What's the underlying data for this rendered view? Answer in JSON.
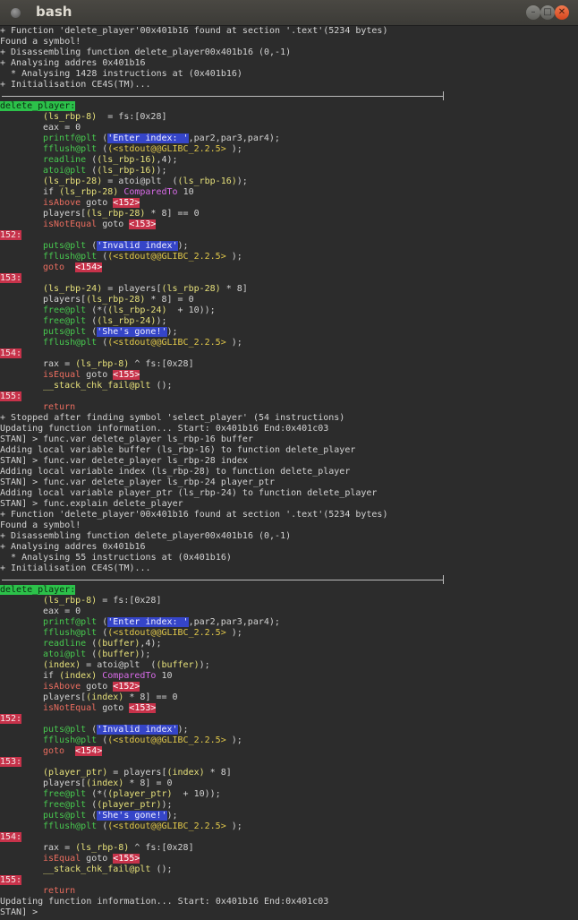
{
  "window": {
    "title": "bash"
  },
  "prompt": "STAN] >",
  "terminal_lines": [
    {
      "t": "text",
      "s": "+ Function 'delete_player'00x401b16 found at section '.text'(5234 bytes)"
    },
    {
      "t": "text",
      "s": "Found a symbol!"
    },
    {
      "t": "text",
      "s": "+ Disassembling function delete_player00x401b16 (0,-1)"
    },
    {
      "t": "text",
      "s": "+ Analysing addres 0x401b16"
    },
    {
      "t": "text",
      "s": "  * Analysing 1428 instructions at (0x401b16)"
    },
    {
      "t": "text",
      "s": "+ Initialisation CE4S(TM)..."
    },
    {
      "t": "sep"
    },
    {
      "t": "label",
      "s": "delete_player:"
    },
    {
      "t": "code",
      "segs": [
        [
          "y",
          "(ls_rbp-8)"
        ],
        [
          "",
          "  = fs:[0x28]"
        ]
      ]
    },
    {
      "t": "code",
      "segs": [
        [
          "",
          "eax = 0"
        ]
      ]
    },
    {
      "t": "code",
      "segs": [
        [
          "g",
          "printf@plt"
        ],
        [
          "",
          " ("
        ],
        [
          "str",
          "'Enter index: '"
        ],
        [
          "",
          ",par2,par3,par4);"
        ]
      ]
    },
    {
      "t": "code",
      "segs": [
        [
          "g",
          "fflush@plt"
        ],
        [
          "",
          " ("
        ],
        [
          "stdout",
          "(<stdout@@GLIBC_2.2.5>"
        ],
        [
          "",
          " );"
        ]
      ]
    },
    {
      "t": "code",
      "segs": [
        [
          "g",
          "readline"
        ],
        [
          "",
          " ("
        ],
        [
          "y",
          "(ls_rbp-16)"
        ],
        [
          "",
          ",4);"
        ]
      ]
    },
    {
      "t": "code",
      "segs": [
        [
          "g",
          "atoi@plt"
        ],
        [
          "",
          " ("
        ],
        [
          "y",
          "(ls_rbp-16)"
        ],
        [
          "",
          ");"
        ]
      ]
    },
    {
      "t": "code",
      "segs": [
        [
          "y",
          "(ls_rbp-28)"
        ],
        [
          "",
          " = atoi@plt  ("
        ],
        [
          "y",
          "(ls_rbp-16)"
        ],
        [
          "",
          ");"
        ]
      ]
    },
    {
      "t": "code",
      "segs": [
        [
          "",
          "if "
        ],
        [
          "y",
          "(ls_rbp-28)"
        ],
        [
          "",
          " "
        ],
        [
          "m",
          "ComparedTo"
        ],
        [
          "",
          " 10"
        ]
      ]
    },
    {
      "t": "code",
      "segs": [
        [
          "r",
          "isAbove"
        ],
        [
          "",
          " goto "
        ],
        [
          "tgt",
          "<152>"
        ]
      ]
    },
    {
      "t": "code",
      "segs": [
        [
          "",
          "players["
        ],
        [
          "y",
          "(ls_rbp-28)"
        ],
        [
          "",
          " * 8] == 0"
        ]
      ]
    },
    {
      "t": "code",
      "segs": [
        [
          "r",
          "isNotEqual"
        ],
        [
          "",
          " goto "
        ],
        [
          "tgt",
          "<153>"
        ]
      ]
    },
    {
      "t": "rlabel",
      "s": "152:"
    },
    {
      "t": "code",
      "segs": [
        [
          "g",
          "puts@plt"
        ],
        [
          "",
          " ("
        ],
        [
          "str",
          "'Invalid index'"
        ],
        [
          "",
          ");"
        ]
      ]
    },
    {
      "t": "code",
      "segs": [
        [
          "g",
          "fflush@plt"
        ],
        [
          "",
          " ("
        ],
        [
          "stdout",
          "(<stdout@@GLIBC_2.2.5>"
        ],
        [
          "",
          " );"
        ]
      ]
    },
    {
      "t": "code",
      "segs": [
        [
          "r",
          "goto"
        ],
        [
          "",
          "  "
        ],
        [
          "tgt",
          "<154>"
        ]
      ]
    },
    {
      "t": "rlabel",
      "s": "153:"
    },
    {
      "t": "code",
      "segs": [
        [
          "y",
          "(ls_rbp-24)"
        ],
        [
          "",
          " = players["
        ],
        [
          "y",
          "(ls_rbp-28)"
        ],
        [
          "",
          " * 8]"
        ]
      ]
    },
    {
      "t": "code",
      "segs": [
        [
          "",
          "players["
        ],
        [
          "y",
          "(ls_rbp-28)"
        ],
        [
          "",
          " * 8] = 0"
        ]
      ]
    },
    {
      "t": "code",
      "segs": [
        [
          "g",
          "free@plt"
        ],
        [
          "",
          " (*("
        ],
        [
          "y",
          "(ls_rbp-24)"
        ],
        [
          "",
          "  + 10));"
        ]
      ]
    },
    {
      "t": "code",
      "segs": [
        [
          "g",
          "free@plt"
        ],
        [
          "",
          " ("
        ],
        [
          "y",
          "(ls_rbp-24)"
        ],
        [
          "",
          ");"
        ]
      ]
    },
    {
      "t": "code",
      "segs": [
        [
          "g",
          "puts@plt"
        ],
        [
          "",
          " ("
        ],
        [
          "str",
          "'She's gone!'"
        ],
        [
          "",
          ");"
        ]
      ]
    },
    {
      "t": "code",
      "segs": [
        [
          "g",
          "fflush@plt"
        ],
        [
          "",
          " ("
        ],
        [
          "stdout",
          "(<stdout@@GLIBC_2.2.5>"
        ],
        [
          "",
          " );"
        ]
      ]
    },
    {
      "t": "rlabel",
      "s": "154:"
    },
    {
      "t": "code",
      "segs": [
        [
          "",
          "rax = "
        ],
        [
          "y",
          "(ls_rbp-8)"
        ],
        [
          "",
          " ^ fs:[0x28]"
        ]
      ]
    },
    {
      "t": "code",
      "segs": [
        [
          "r",
          "isEqual"
        ],
        [
          "",
          " goto "
        ],
        [
          "tgt",
          "<155>"
        ]
      ]
    },
    {
      "t": "code",
      "segs": [
        [
          "y",
          "__stack_chk_fail@plt"
        ],
        [
          "",
          " ();"
        ]
      ]
    },
    {
      "t": "rlabel",
      "s": "155:"
    },
    {
      "t": "code",
      "segs": [
        [
          "r",
          "return"
        ]
      ]
    },
    {
      "t": "text",
      "s": "+ Stopped after finding symbol 'select_player' (54 instructions)"
    },
    {
      "t": "text",
      "s": "Updating function information... Start: 0x401b16 End:0x401c03"
    },
    {
      "t": "text",
      "s": "STAN] > func.var delete_player ls_rbp-16 buffer"
    },
    {
      "t": "text",
      "s": "Adding local variable buffer (ls_rbp-16) to function delete_player"
    },
    {
      "t": "text",
      "s": "STAN] > func.var delete_player ls_rbp-28 index"
    },
    {
      "t": "text",
      "s": "Adding local variable index (ls_rbp-28) to function delete_player"
    },
    {
      "t": "text",
      "s": "STAN] > func.var delete_player ls_rbp-24 player_ptr"
    },
    {
      "t": "text",
      "s": "Adding local variable player_ptr (ls_rbp-24) to function delete_player"
    },
    {
      "t": "text",
      "s": "STAN] > func.explain delete_player"
    },
    {
      "t": "text",
      "s": "+ Function 'delete_player'00x401b16 found at section '.text'(5234 bytes)"
    },
    {
      "t": "text",
      "s": "Found a symbol!"
    },
    {
      "t": "text",
      "s": "+ Disassembling function delete_player00x401b16 (0,-1)"
    },
    {
      "t": "text",
      "s": "+ Analysing addres 0x401b16"
    },
    {
      "t": "text",
      "s": "  * Analysing 55 instructions at (0x401b16)"
    },
    {
      "t": "text",
      "s": "+ Initialisation CE4S(TM)..."
    },
    {
      "t": "sep"
    },
    {
      "t": "label",
      "s": "delete_player:"
    },
    {
      "t": "code",
      "segs": [
        [
          "y",
          "(ls_rbp-8)"
        ],
        [
          "",
          " = fs:[0x28]"
        ]
      ]
    },
    {
      "t": "code",
      "segs": [
        [
          "",
          "eax = 0"
        ]
      ]
    },
    {
      "t": "code",
      "segs": [
        [
          "g",
          "printf@plt"
        ],
        [
          "",
          " ("
        ],
        [
          "str",
          "'Enter index: '"
        ],
        [
          "",
          ",par2,par3,par4);"
        ]
      ]
    },
    {
      "t": "code",
      "segs": [
        [
          "g",
          "fflush@plt"
        ],
        [
          "",
          " ("
        ],
        [
          "stdout",
          "(<stdout@@GLIBC_2.2.5>"
        ],
        [
          "",
          " );"
        ]
      ]
    },
    {
      "t": "code",
      "segs": [
        [
          "g",
          "readline"
        ],
        [
          "",
          " ("
        ],
        [
          "y",
          "(buffer)"
        ],
        [
          "",
          ",4);"
        ]
      ]
    },
    {
      "t": "code",
      "segs": [
        [
          "g",
          "atoi@plt"
        ],
        [
          "",
          " ("
        ],
        [
          "y",
          "(buffer)"
        ],
        [
          "",
          ");"
        ]
      ]
    },
    {
      "t": "code",
      "segs": [
        [
          "y",
          "(index)"
        ],
        [
          "",
          " = atoi@plt  ("
        ],
        [
          "y",
          "(buffer)"
        ],
        [
          "",
          ");"
        ]
      ]
    },
    {
      "t": "code",
      "segs": [
        [
          "",
          "if "
        ],
        [
          "y",
          "(index)"
        ],
        [
          "",
          " "
        ],
        [
          "m",
          "ComparedTo"
        ],
        [
          "",
          " 10"
        ]
      ]
    },
    {
      "t": "code",
      "segs": [
        [
          "r",
          "isAbove"
        ],
        [
          "",
          " goto "
        ],
        [
          "tgt",
          "<152>"
        ]
      ]
    },
    {
      "t": "code",
      "segs": [
        [
          "",
          "players["
        ],
        [
          "y",
          "(index)"
        ],
        [
          "",
          " * 8] == 0"
        ]
      ]
    },
    {
      "t": "code",
      "segs": [
        [
          "r",
          "isNotEqual"
        ],
        [
          "",
          " goto "
        ],
        [
          "tgt",
          "<153>"
        ]
      ]
    },
    {
      "t": "rlabel",
      "s": "152:"
    },
    {
      "t": "code",
      "segs": [
        [
          "g",
          "puts@plt"
        ],
        [
          "",
          " ("
        ],
        [
          "str",
          "'Invalid index'"
        ],
        [
          "",
          ");"
        ]
      ]
    },
    {
      "t": "code",
      "segs": [
        [
          "g",
          "fflush@plt"
        ],
        [
          "",
          " ("
        ],
        [
          "stdout",
          "(<stdout@@GLIBC_2.2.5>"
        ],
        [
          "",
          " );"
        ]
      ]
    },
    {
      "t": "code",
      "segs": [
        [
          "r",
          "goto"
        ],
        [
          "",
          "  "
        ],
        [
          "tgt",
          "<154>"
        ]
      ]
    },
    {
      "t": "rlabel",
      "s": "153:"
    },
    {
      "t": "code",
      "segs": [
        [
          "y",
          "(player_ptr)"
        ],
        [
          "",
          " = players["
        ],
        [
          "y",
          "(index)"
        ],
        [
          "",
          " * 8]"
        ]
      ]
    },
    {
      "t": "code",
      "segs": [
        [
          "",
          "players["
        ],
        [
          "y",
          "(index)"
        ],
        [
          "",
          " * 8] = 0"
        ]
      ]
    },
    {
      "t": "code",
      "segs": [
        [
          "g",
          "free@plt"
        ],
        [
          "",
          " (*("
        ],
        [
          "y",
          "(player_ptr)"
        ],
        [
          "",
          "  + 10));"
        ]
      ]
    },
    {
      "t": "code",
      "segs": [
        [
          "g",
          "free@plt"
        ],
        [
          "",
          " ("
        ],
        [
          "y",
          "(player_ptr)"
        ],
        [
          "",
          ");"
        ]
      ]
    },
    {
      "t": "code",
      "segs": [
        [
          "g",
          "puts@plt"
        ],
        [
          "",
          " ("
        ],
        [
          "str",
          "'She's gone!'"
        ],
        [
          "",
          ");"
        ]
      ]
    },
    {
      "t": "code",
      "segs": [
        [
          "g",
          "fflush@plt"
        ],
        [
          "",
          " ("
        ],
        [
          "stdout",
          "(<stdout@@GLIBC_2.2.5>"
        ],
        [
          "",
          " );"
        ]
      ]
    },
    {
      "t": "rlabel",
      "s": "154:"
    },
    {
      "t": "code",
      "segs": [
        [
          "",
          "rax = "
        ],
        [
          "y",
          "(ls_rbp-8)"
        ],
        [
          "",
          " ^ fs:[0x28]"
        ]
      ]
    },
    {
      "t": "code",
      "segs": [
        [
          "r",
          "isEqual"
        ],
        [
          "",
          " goto "
        ],
        [
          "tgt",
          "<155>"
        ]
      ]
    },
    {
      "t": "code",
      "segs": [
        [
          "y",
          "__stack_chk_fail@plt"
        ],
        [
          "",
          " ();"
        ]
      ]
    },
    {
      "t": "rlabel",
      "s": "155:"
    },
    {
      "t": "code",
      "segs": [
        [
          "r",
          "return"
        ]
      ]
    },
    {
      "t": "text",
      "s": "Updating function information... Start: 0x401b16 End:0x401c03"
    }
  ]
}
